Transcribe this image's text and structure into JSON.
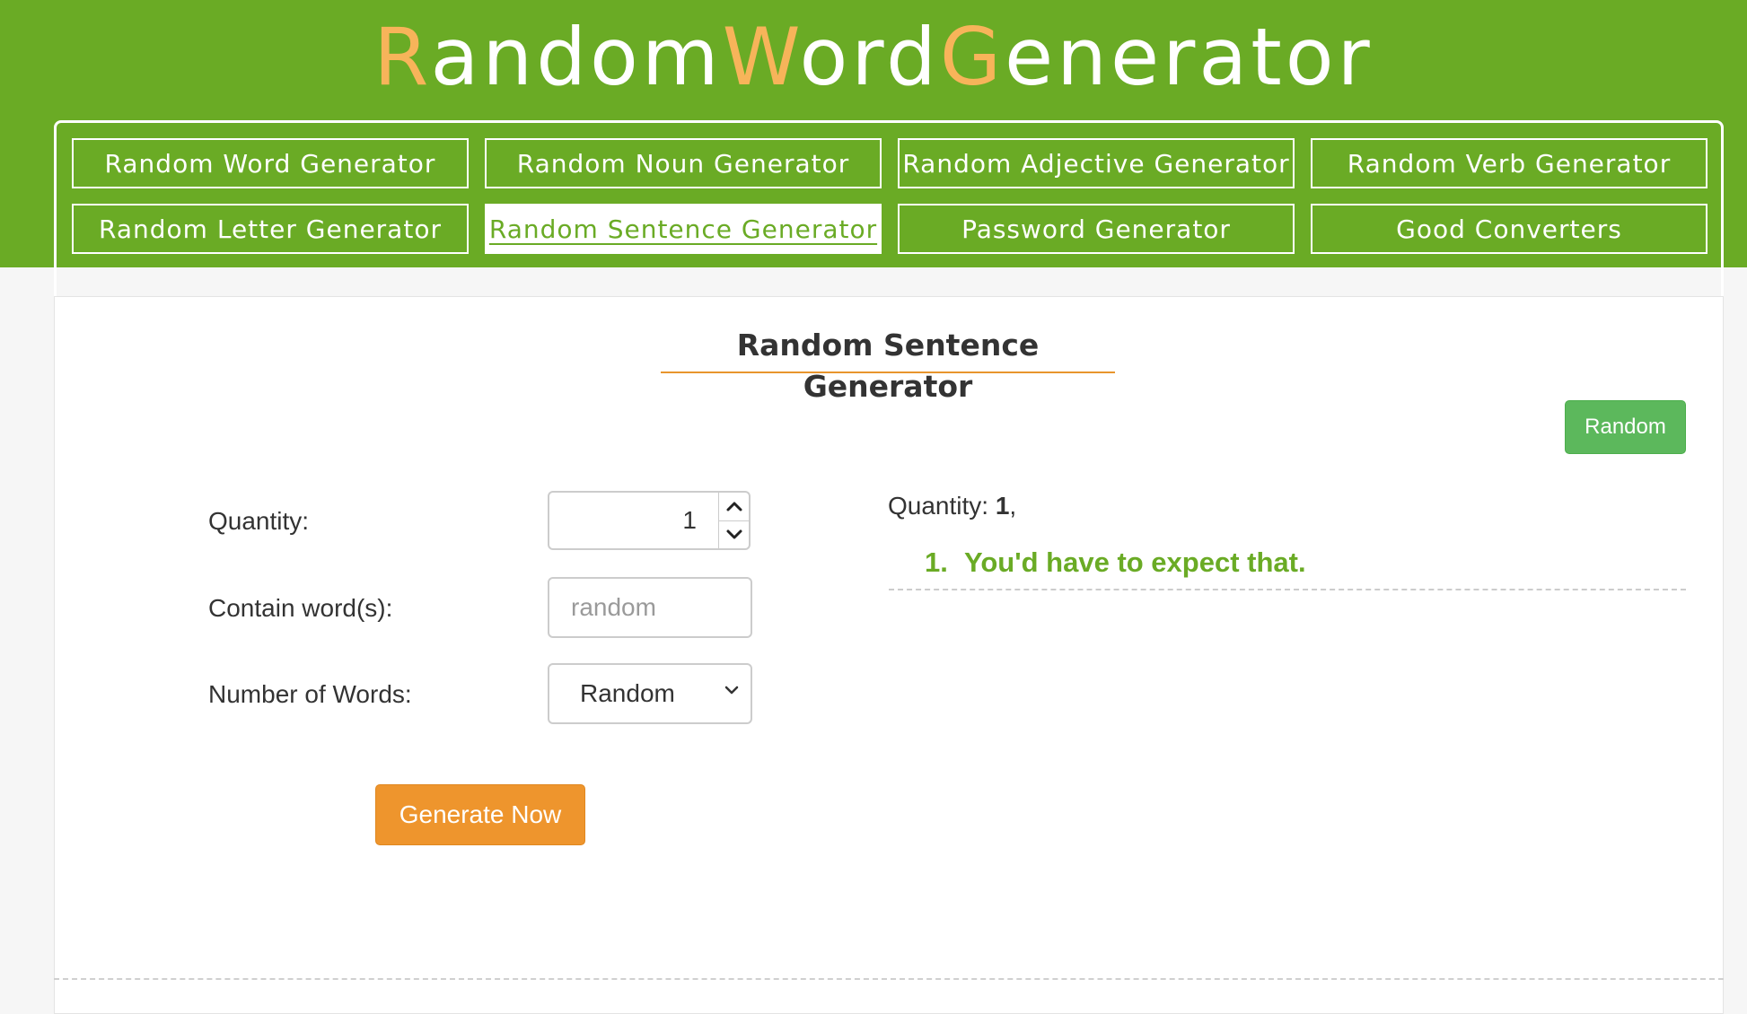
{
  "header": {
    "logo_parts": [
      {
        "text": "R",
        "accent": true
      },
      {
        "text": "andom",
        "accent": false
      },
      {
        "text": "W",
        "accent": true
      },
      {
        "text": "ord",
        "accent": false
      },
      {
        "text": "G",
        "accent": true
      },
      {
        "text": "enerator",
        "accent": false
      }
    ]
  },
  "nav": {
    "items": [
      {
        "label": "Random Word Generator"
      },
      {
        "label": "Random Noun Generator"
      },
      {
        "label": "Random Adjective Generator"
      },
      {
        "label": "Random Verb Generator"
      },
      {
        "label": "Random Letter Generator"
      },
      {
        "label": "Random Sentence Generator",
        "active": true
      },
      {
        "label": "Password Generator"
      },
      {
        "label": "Good Converters"
      }
    ]
  },
  "page": {
    "title": "Random Sentence Generator",
    "random_button": "Random"
  },
  "form": {
    "quantity_label": "Quantity:",
    "quantity_value": "1",
    "contain_label": "Contain word(s):",
    "contain_placeholder": "random",
    "words_label": "Number of Words:",
    "words_selected": "Random",
    "generate_button": "Generate Now"
  },
  "result": {
    "quantity_prefix": "Quantity:",
    "quantity_value": "1",
    "quantity_suffix": ",",
    "items": [
      {
        "num": "1.",
        "text": "You'd have to expect that."
      }
    ]
  },
  "colors": {
    "brand_green": "#6aab25",
    "accent_orange": "#ee952d",
    "logo_accent": "#f7b45a",
    "button_green": "#5cb85c"
  },
  "icons": {
    "spinner_up": "chevron-up-icon",
    "spinner_down": "chevron-down-icon",
    "select_arrow": "chevron-down-icon"
  }
}
